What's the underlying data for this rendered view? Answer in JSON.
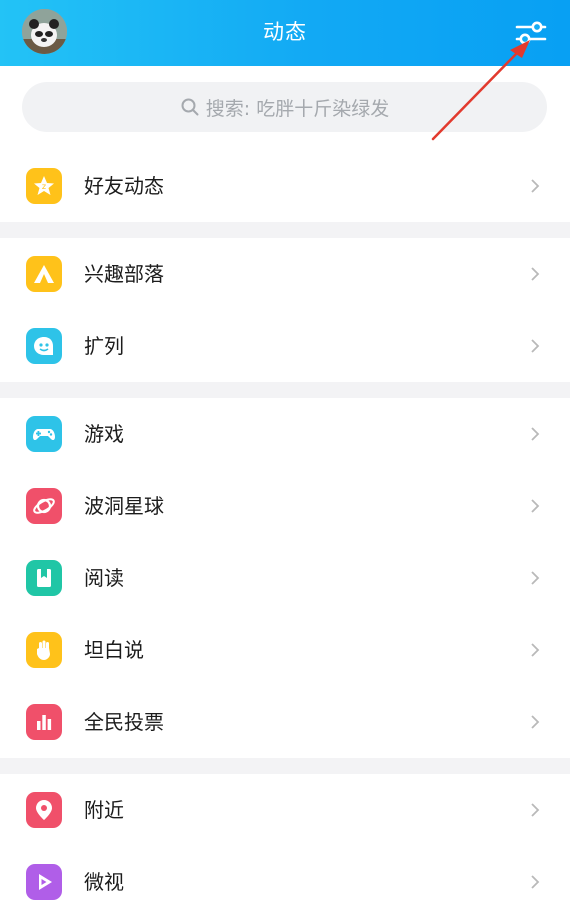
{
  "header": {
    "title": "动态"
  },
  "search": {
    "placeholder": "搜索: 吃胖十斤染绿发"
  },
  "items": [
    {
      "label": "好友动态",
      "icon": "star-badge-icon",
      "color": "#ffc21a"
    },
    {
      "label": "兴趣部落",
      "icon": "tent-icon",
      "color": "#ffc21a"
    },
    {
      "label": "扩列",
      "icon": "chat-face-icon",
      "color": "#2ec3e8"
    },
    {
      "label": "游戏",
      "icon": "gamepad-icon",
      "color": "#2ec3e8"
    },
    {
      "label": "波洞星球",
      "icon": "planet-icon",
      "color": "#f0506a"
    },
    {
      "label": "阅读",
      "icon": "book-icon",
      "color": "#20c6a6"
    },
    {
      "label": "坦白说",
      "icon": "hand-icon",
      "color": "#ffc21a"
    },
    {
      "label": "全民投票",
      "icon": "bar-chart-icon",
      "color": "#f0506a"
    },
    {
      "label": "附近",
      "icon": "location-pin-icon",
      "color": "#f0506a"
    },
    {
      "label": "微视",
      "icon": "play-icon",
      "color": "#b05ee8"
    }
  ],
  "colors": {
    "header_start": "#23c3f6",
    "header_end": "#08a0f3",
    "annotation": "#e23a2e"
  }
}
